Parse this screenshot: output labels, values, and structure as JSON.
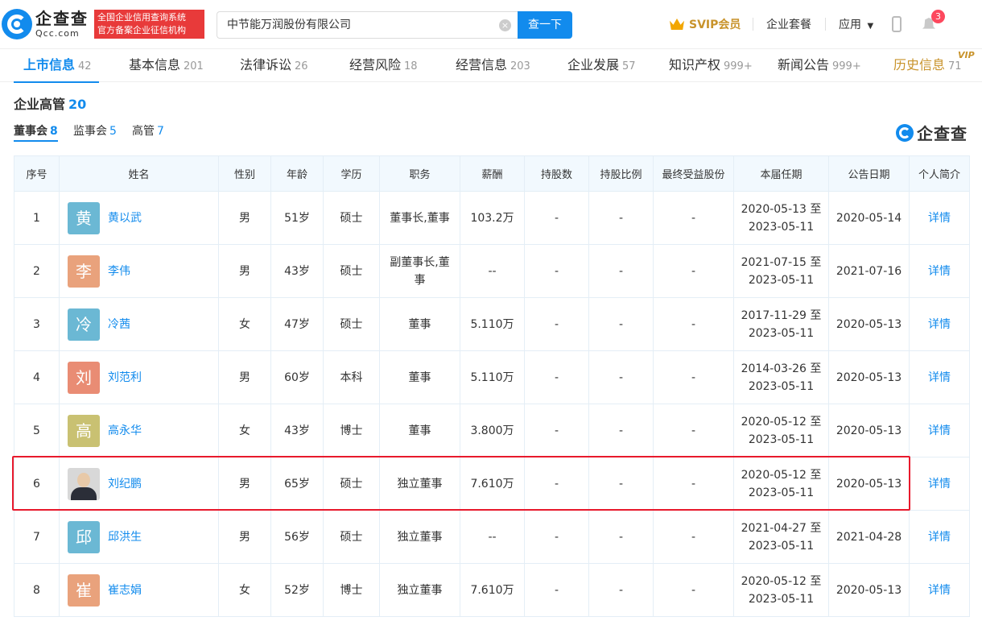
{
  "header": {
    "logo_cn": "企查查",
    "logo_en": "Qcc.com",
    "badge_line1": "全国企业信用查询系统",
    "badge_line2": "官方备案企业征信机构",
    "search_value": "中节能万润股份有限公司",
    "search_button": "查一下",
    "svip": "SVIP会员",
    "package": "企业套餐",
    "apps": "应用",
    "notification_count": "3"
  },
  "tabs": [
    {
      "label": "上市信息",
      "count": "42"
    },
    {
      "label": "基本信息",
      "count": "201"
    },
    {
      "label": "法律诉讼",
      "count": "26"
    },
    {
      "label": "经营风险",
      "count": "18"
    },
    {
      "label": "经营信息",
      "count": "203"
    },
    {
      "label": "企业发展",
      "count": "57"
    },
    {
      "label": "知识产权",
      "count": "999+"
    },
    {
      "label": "新闻公告",
      "count": "999+"
    },
    {
      "label": "历史信息",
      "count": "71"
    }
  ],
  "vip_tag": "VIP",
  "section": {
    "title": "企业高管",
    "count": "20",
    "subtabs": [
      {
        "label": "董事会",
        "count": "8"
      },
      {
        "label": "监事会",
        "count": "5"
      },
      {
        "label": "高管",
        "count": "7"
      }
    ],
    "watermark": "企查查"
  },
  "table": {
    "headers": [
      "序号",
      "姓名",
      "性别",
      "年龄",
      "学历",
      "职务",
      "薪酬",
      "持股数",
      "持股比例",
      "最终受益股份",
      "本届任期",
      "公告日期",
      "个人简介"
    ],
    "rows": [
      {
        "no": "1",
        "avatar": "黄",
        "avatar_color": "#6bb8d4",
        "name": "黄以武",
        "gender": "男",
        "age": "51岁",
        "edu": "硕士",
        "role": "董事长,董事",
        "salary": "103.2万",
        "shares": "-",
        "ratio": "-",
        "benefit": "-",
        "term_start": "2020-05-13 至",
        "term_end": "2023-05-11",
        "date": "2020-05-14",
        "detail": "详情"
      },
      {
        "no": "2",
        "avatar": "李",
        "avatar_color": "#e9a27c",
        "name": "李伟",
        "gender": "男",
        "age": "43岁",
        "edu": "硕士",
        "role": "副董事长,董事",
        "salary": "--",
        "shares": "-",
        "ratio": "-",
        "benefit": "-",
        "term_start": "2021-07-15 至",
        "term_end": "2023-05-11",
        "date": "2021-07-16",
        "detail": "详情"
      },
      {
        "no": "3",
        "avatar": "冷",
        "avatar_color": "#6bb8d4",
        "name": "冷茜",
        "gender": "女",
        "age": "47岁",
        "edu": "硕士",
        "role": "董事",
        "salary": "5.110万",
        "shares": "-",
        "ratio": "-",
        "benefit": "-",
        "term_start": "2017-11-29 至",
        "term_end": "2023-05-11",
        "date": "2020-05-13",
        "detail": "详情"
      },
      {
        "no": "4",
        "avatar": "刘",
        "avatar_color": "#e98c74",
        "name": "刘范利",
        "gender": "男",
        "age": "60岁",
        "edu": "本科",
        "role": "董事",
        "salary": "5.110万",
        "shares": "-",
        "ratio": "-",
        "benefit": "-",
        "term_start": "2014-03-26 至",
        "term_end": "2023-05-11",
        "date": "2020-05-13",
        "detail": "详情"
      },
      {
        "no": "5",
        "avatar": "高",
        "avatar_color": "#c9c172",
        "name": "高永华",
        "gender": "女",
        "age": "43岁",
        "edu": "博士",
        "role": "董事",
        "salary": "3.800万",
        "shares": "-",
        "ratio": "-",
        "benefit": "-",
        "term_start": "2020-05-12 至",
        "term_end": "2023-05-11",
        "date": "2020-05-13",
        "detail": "详情"
      },
      {
        "no": "6",
        "avatar": "",
        "avatar_color": "",
        "name": "刘纪鹏",
        "gender": "男",
        "age": "65岁",
        "edu": "硕士",
        "role": "独立董事",
        "salary": "7.610万",
        "shares": "-",
        "ratio": "-",
        "benefit": "-",
        "term_start": "2020-05-12 至",
        "term_end": "2023-05-11",
        "date": "2020-05-13",
        "detail": "详情"
      },
      {
        "no": "7",
        "avatar": "邱",
        "avatar_color": "#6bb8d4",
        "name": "邱洪生",
        "gender": "男",
        "age": "56岁",
        "edu": "硕士",
        "role": "独立董事",
        "salary": "--",
        "shares": "-",
        "ratio": "-",
        "benefit": "-",
        "term_start": "2021-04-27 至",
        "term_end": "2023-05-11",
        "date": "2021-04-28",
        "detail": "详情"
      },
      {
        "no": "8",
        "avatar": "崔",
        "avatar_color": "#e9a27c",
        "name": "崔志娟",
        "gender": "女",
        "age": "52岁",
        "edu": "博士",
        "role": "独立董事",
        "salary": "7.610万",
        "shares": "-",
        "ratio": "-",
        "benefit": "-",
        "term_start": "2020-05-12 至",
        "term_end": "2023-05-11",
        "date": "2020-05-13",
        "detail": "详情"
      }
    ]
  },
  "colors": {
    "accent": "#128bed",
    "highlight": "#e8192c",
    "vip": "#c8932b"
  }
}
